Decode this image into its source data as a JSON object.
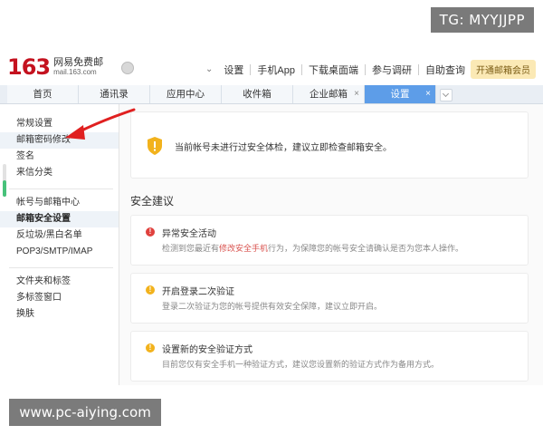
{
  "watermarks": {
    "tg": "TG: MYYJJPP",
    "site": "www.pc-aiying.com"
  },
  "logo": {
    "number": "163",
    "cn": "网易免费邮",
    "domain": "mail.163.com"
  },
  "topnav": {
    "items": [
      "设置",
      "手机App",
      "下载桌面端",
      "参与调研",
      "自助查询"
    ],
    "vip": "开通邮箱会员"
  },
  "tabs": [
    {
      "label": "首页",
      "closable": false,
      "active": false
    },
    {
      "label": "通讯录",
      "closable": false,
      "active": false
    },
    {
      "label": "应用中心",
      "closable": false,
      "active": false
    },
    {
      "label": "收件箱",
      "closable": false,
      "active": false
    },
    {
      "label": "企业邮箱",
      "closable": true,
      "active": false
    },
    {
      "label": "设置",
      "closable": true,
      "active": true
    }
  ],
  "sidebar": {
    "items": [
      {
        "label": "常规设置"
      },
      {
        "label": "邮箱密码修改"
      },
      {
        "label": "签名"
      },
      {
        "label": "来信分类"
      },
      {
        "label": "帐号与邮箱中心"
      },
      {
        "label": "邮箱安全设置"
      },
      {
        "label": "反垃圾/黑白名单"
      },
      {
        "label": "POP3/SMTP/IMAP"
      },
      {
        "label": "文件夹和标签"
      },
      {
        "label": "多标签窗口"
      },
      {
        "label": "换肤"
      }
    ]
  },
  "main": {
    "alert": "当前帐号未进行过安全体检，建议立即检查邮箱安全。",
    "section_title": "安全建议",
    "cards": [
      {
        "title": "异常安全活动",
        "desc_before": "检测到您最近有",
        "desc_link": "修改安全手机",
        "desc_after": "行为，为保障您的帐号安全请确认是否为您本人操作。"
      },
      {
        "title": "开启登录二次验证",
        "desc": "登录二次验证为您的帐号提供有效安全保障，建议立即开启。"
      },
      {
        "title": "设置新的安全验证方式",
        "desc": "目前您仅有安全手机一种验证方式，建议您设置新的验证方式作为备用方式。"
      }
    ]
  },
  "colors": {
    "brand_red": "#c4121f",
    "active_tab": "#5d9de8",
    "arrow": "#e02020",
    "danger": "#e0413d",
    "warning": "#f2b21c"
  },
  "icons": {
    "shield": "shield-icon",
    "danger": "exclamation-circle-red-icon",
    "warning": "exclamation-circle-yellow-icon",
    "annotation": "red-arrow-icon"
  }
}
